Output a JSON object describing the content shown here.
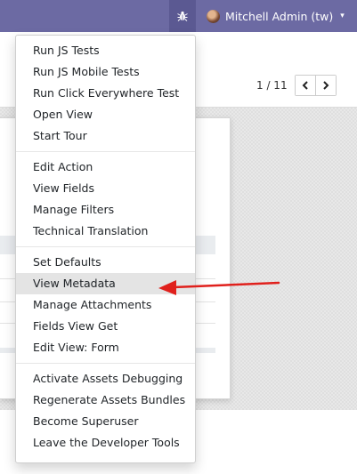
{
  "topbar": {
    "debug_icon": "bug-icon",
    "user_name": "Mitchell Admin (tw)",
    "user_caret": "▾",
    "colors": {
      "background": "#6c6aa3",
      "debug_button": "#5b5992"
    }
  },
  "pager": {
    "value": "1 / 11",
    "prev_icon": "chevron-left-icon",
    "next_icon": "chevron-right-icon"
  },
  "debug_menu": {
    "groups": [
      {
        "items": [
          "Run JS Tests",
          "Run JS Mobile Tests",
          "Run Click Everywhere Test",
          "Open View",
          "Start Tour"
        ]
      },
      {
        "items": [
          "Edit Action",
          "View Fields",
          "Manage Filters",
          "Technical Translation"
        ]
      },
      {
        "items": [
          "Set Defaults",
          "View Metadata",
          "Manage Attachments",
          "Fields View Get",
          "Edit View: Form"
        ]
      },
      {
        "items": [
          "Activate Assets Debugging",
          "Regenerate Assets Bundles",
          "Become Superuser",
          "Leave the Developer Tools"
        ]
      }
    ],
    "highlighted_item": "View Metadata"
  },
  "annotation": {
    "arrow_color": "#e0201c",
    "points_to": "View Metadata"
  }
}
